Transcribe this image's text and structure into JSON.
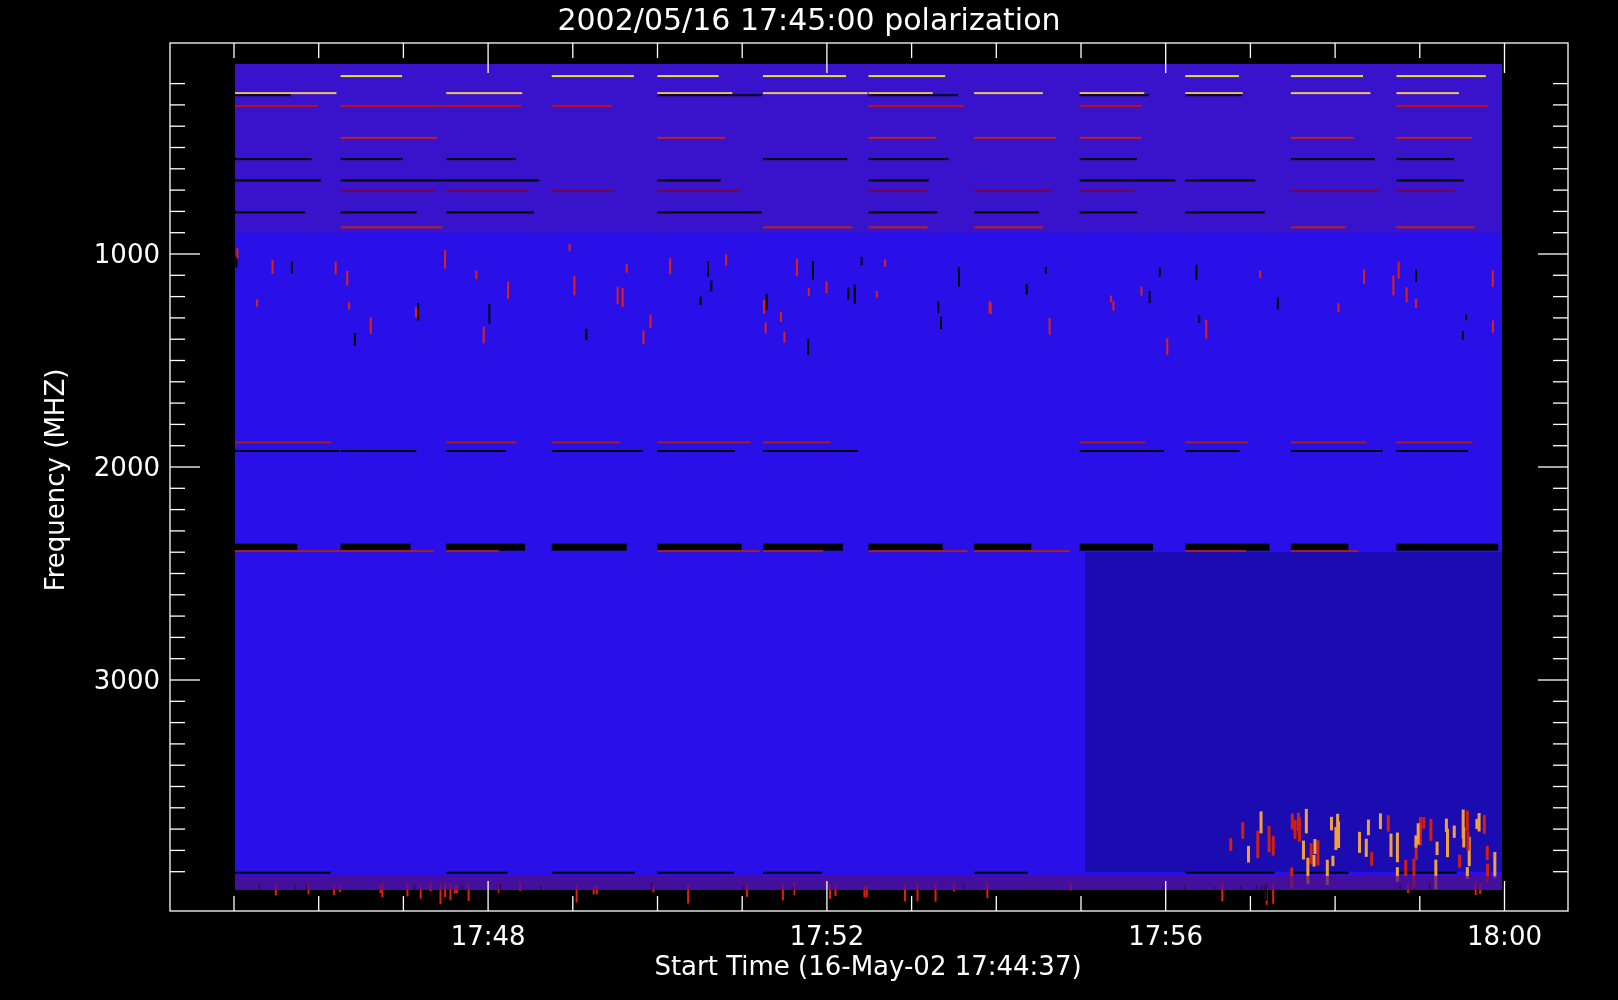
{
  "plot": {
    "title": "2002/05/16 17:45:00 polarization",
    "ylabel": "Frequency (MHZ)",
    "xlabel": "Start Time (16-May-02 17:44:37)",
    "y_tick_labels": [
      "1000",
      "2000",
      "3000"
    ],
    "x_tick_labels": [
      "17:48",
      "17:52",
      "17:56",
      "18:00"
    ]
  }
}
